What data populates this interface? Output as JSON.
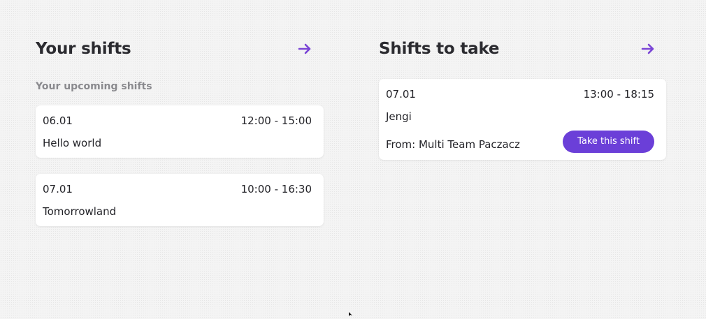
{
  "your_shifts": {
    "title": "Your shifts",
    "arrow_icon": "arrow-right-icon",
    "subheading": "Your upcoming shifts",
    "shifts": [
      {
        "date": "06.01",
        "time": "12:00 - 15:00",
        "name": "Hello world"
      },
      {
        "date": "07.01",
        "time": "10:00 - 16:30",
        "name": "Tomorrowland"
      }
    ]
  },
  "shifts_to_take": {
    "title": "Shifts to take",
    "arrow_icon": "arrow-right-icon",
    "shifts": [
      {
        "date": "07.01",
        "time": "13:00 - 18:15",
        "name": "Jengi",
        "from": "From: Multi Team Paczacz",
        "action_label": "Take this shift"
      }
    ]
  },
  "colors": {
    "accent": "#6b3fd8",
    "arrow": "#7a45d6",
    "card_bg": "#ffffff",
    "muted_text": "#8a8a8e"
  }
}
